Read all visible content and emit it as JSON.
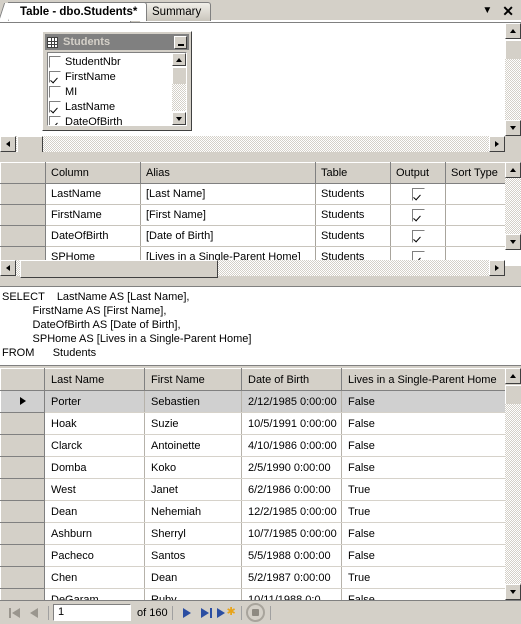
{
  "window": {
    "tabs": [
      {
        "label": "Table - dbo.Students*",
        "active": true
      },
      {
        "label": "Summary",
        "active": false
      }
    ],
    "dropdown_icon": "chevron-down-icon",
    "close_icon": "close-icon"
  },
  "diagram": {
    "table_name": "Students",
    "table_icon": "table-grid-icon",
    "minimize_label": "_",
    "columns": [
      {
        "name": "StudentNbr",
        "checked": false
      },
      {
        "name": "FirstName",
        "checked": true
      },
      {
        "name": "MI",
        "checked": false
      },
      {
        "name": "LastName",
        "checked": true
      },
      {
        "name": "DateOfBirth",
        "checked": true
      }
    ]
  },
  "criteria": {
    "headers": [
      "",
      "Column",
      "Alias",
      "Table",
      "Output",
      "Sort Type"
    ],
    "rows": [
      {
        "column": "LastName",
        "alias": "[Last Name]",
        "table": "Students",
        "output": true,
        "sort_type": ""
      },
      {
        "column": "FirstName",
        "alias": "[First Name]",
        "table": "Students",
        "output": true,
        "sort_type": ""
      },
      {
        "column": "DateOfBirth",
        "alias": "[Date of Birth]",
        "table": "Students",
        "output": true,
        "sort_type": ""
      },
      {
        "column": "SPHome",
        "alias": "[Lives in a Single-Parent Home]",
        "table": "Students",
        "output": true,
        "sort_type": ""
      }
    ]
  },
  "sql": {
    "text": "SELECT    LastName AS [Last Name],\n          FirstName AS [First Name],\n          DateOfBirth AS [Date of Birth],\n          SPHome AS [Lives in a Single-Parent Home]\nFROM      Students"
  },
  "results": {
    "headers": [
      "Last Name",
      "First Name",
      "Date of Birth",
      "Lives in a Single-Parent Home"
    ],
    "rows": [
      {
        "last_name": "Porter",
        "first_name": "Sebastien",
        "dob": "2/12/1985 0:00:00",
        "sphome": "False",
        "selected": true
      },
      {
        "last_name": "Hoak",
        "first_name": "Suzie",
        "dob": "10/5/1991 0:00:00",
        "sphome": "False",
        "selected": false
      },
      {
        "last_name": "Clarck",
        "first_name": "Antoinette",
        "dob": "4/10/1986 0:00:00",
        "sphome": "False",
        "selected": false
      },
      {
        "last_name": "Domba",
        "first_name": "Koko",
        "dob": "2/5/1990 0:00:00",
        "sphome": "False",
        "selected": false
      },
      {
        "last_name": "West",
        "first_name": "Janet",
        "dob": "6/2/1986 0:00:00",
        "sphome": "True",
        "selected": false
      },
      {
        "last_name": "Dean",
        "first_name": "Nehemiah",
        "dob": "12/2/1985 0:00:00",
        "sphome": "True",
        "selected": false
      },
      {
        "last_name": "Ashburn",
        "first_name": "Sherryl",
        "dob": "10/7/1985 0:00:00",
        "sphome": "False",
        "selected": false
      },
      {
        "last_name": "Pacheco",
        "first_name": "Santos",
        "dob": "5/5/1988 0:00:00",
        "sphome": "False",
        "selected": false
      },
      {
        "last_name": "Chen",
        "first_name": "Dean",
        "dob": "5/2/1987 0:00:00",
        "sphome": "True",
        "selected": false
      },
      {
        "last_name": "DeGaram",
        "first_name": "Ruby",
        "dob": "10/11/1988 0:0…",
        "sphome": "False",
        "selected": false
      }
    ]
  },
  "navigation": {
    "first_icon": "first-record-icon",
    "prev_icon": "previous-record-icon",
    "page_value": "1",
    "of_label": "of 160",
    "next_icon": "next-record-icon",
    "last_icon": "last-record-icon",
    "new_icon": "new-record-icon",
    "stop_icon": "stop-icon"
  },
  "colors": {
    "face": "#d4d0c8",
    "title_inactive": "#808080",
    "accent_blue": "#2b4ea2",
    "accent_yellow": "#e8a317"
  }
}
